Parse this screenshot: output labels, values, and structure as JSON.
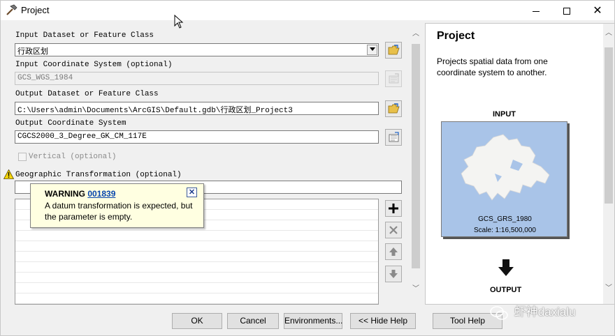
{
  "window": {
    "title": "Project",
    "controls": {
      "minimize_icon": "minimize-icon",
      "maximize_icon": "maximize-icon",
      "close_icon": "close-icon"
    }
  },
  "form": {
    "input_dataset": {
      "label": "Input Dataset or Feature Class",
      "value": "行政区划"
    },
    "input_coord": {
      "label": "Input Coordinate System (optional)",
      "value": "GCS_WGS_1984"
    },
    "output_dataset": {
      "label": "Output Dataset or Feature Class",
      "value": "C:\\Users\\admin\\Documents\\ArcGIS\\Default.gdb\\行政区划_Project3"
    },
    "output_coord": {
      "label": "Output Coordinate System",
      "value": "CGCS2000_3_Degree_GK_CM_117E"
    },
    "vertical": {
      "label": "Vertical (optional)",
      "checked": false
    },
    "geo_transform": {
      "label": "Geographic Transformation (optional)",
      "value": ""
    }
  },
  "tooltip": {
    "title": "WARNING",
    "code": "001839",
    "body": "A datum transformation is expected, but the parameter is empty."
  },
  "help": {
    "title": "Project",
    "description": "Projects spatial data from one coordinate system to another.",
    "input_label": "INPUT",
    "map_caption_1": "GCS_GRS_1980",
    "map_caption_2": "Scale: 1:16,500,000",
    "output_label": "OUTPUT",
    "map_color": "#a9c4e8"
  },
  "buttons": {
    "ok": "OK",
    "cancel": "Cancel",
    "environments": "Environments...",
    "hide_help": "<< Hide Help",
    "tool_help": "Tool Help"
  },
  "watermark": {
    "text": "虾神daxialu"
  }
}
